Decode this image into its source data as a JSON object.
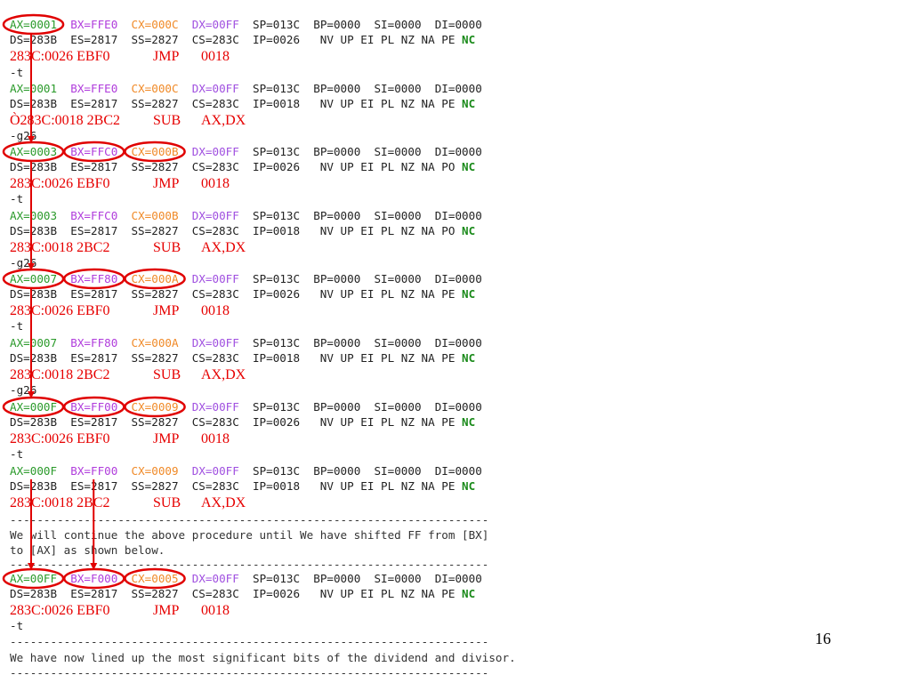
{
  "colors": {
    "ax": "#2a9a2a",
    "bx": "#b03cdc",
    "cx": "#f08a28",
    "dx": "#a050e0",
    "plain": "#222222",
    "nc": "#1a8a1a",
    "instruction": "#e60000",
    "annotation": "#e00000"
  },
  "page_number": "16",
  "lines": [
    {
      "kind": "regs",
      "parts": [
        {
          "text": "AX=0001",
          "reg": "ax"
        },
        {
          "text": "  "
        },
        {
          "text": "BX=FFE0",
          "reg": "bx"
        },
        {
          "text": "  "
        },
        {
          "text": "CX=000C",
          "reg": "cx"
        },
        {
          "text": "  "
        },
        {
          "text": "DX=00FF",
          "reg": "dx"
        },
        {
          "text": "  SP=013C  BP=0000  SI=0000  DI=0000"
        }
      ]
    },
    {
      "kind": "seg",
      "text": "DS=283B  ES=2817  SS=2827  CS=283C  IP=0026   NV UP EI PL NZ NA PE ",
      "flag": "NC"
    },
    {
      "kind": "instr",
      "addr": "283C:0026 EBF0",
      "op": "JMP",
      "arg": "0018"
    },
    {
      "kind": "cmd",
      "text": "-t"
    },
    {
      "kind": "regs",
      "parts": [
        {
          "text": "AX=0001",
          "reg": "ax"
        },
        {
          "text": "  "
        },
        {
          "text": "BX=FFE0",
          "reg": "bx"
        },
        {
          "text": "  "
        },
        {
          "text": "CX=000C",
          "reg": "cx"
        },
        {
          "text": "  "
        },
        {
          "text": "DX=00FF",
          "reg": "dx"
        },
        {
          "text": "  SP=013C  BP=0000  SI=0000  DI=0000"
        }
      ]
    },
    {
      "kind": "seg",
      "text": "DS=283B  ES=2817  SS=2827  CS=283C  IP=0018   NV UP EI PL NZ NA PE ",
      "flag": "NC"
    },
    {
      "kind": "instr",
      "addr": "Ò283C:0018 2BC2",
      "op": "SUB",
      "arg": "AX,DX"
    },
    {
      "kind": "cmd",
      "text": "-g26"
    },
    {
      "kind": "regs",
      "parts": [
        {
          "text": "AX=0003",
          "reg": "ax"
        },
        {
          "text": "  "
        },
        {
          "text": "BX=FFC0",
          "reg": "bx"
        },
        {
          "text": "  "
        },
        {
          "text": "CX=000B",
          "reg": "cx"
        },
        {
          "text": "  "
        },
        {
          "text": "DX=00FF",
          "reg": "dx"
        },
        {
          "text": "  SP=013C  BP=0000  SI=0000  DI=0000"
        }
      ]
    },
    {
      "kind": "seg",
      "text": "DS=283B  ES=2817  SS=2827  CS=283C  IP=0026   NV UP EI PL NZ NA PO ",
      "flag": "NC"
    },
    {
      "kind": "instr",
      "addr": "283C:0026 EBF0",
      "op": "JMP",
      "arg": "0018"
    },
    {
      "kind": "cmd",
      "text": "-t"
    },
    {
      "kind": "regs",
      "parts": [
        {
          "text": "AX=0003",
          "reg": "ax"
        },
        {
          "text": "  "
        },
        {
          "text": "BX=FFC0",
          "reg": "bx"
        },
        {
          "text": "  "
        },
        {
          "text": "CX=000B",
          "reg": "cx"
        },
        {
          "text": "  "
        },
        {
          "text": "DX=00FF",
          "reg": "dx"
        },
        {
          "text": "  SP=013C  BP=0000  SI=0000  DI=0000"
        }
      ]
    },
    {
      "kind": "seg",
      "text": "DS=283B  ES=2817  SS=2827  CS=283C  IP=0018   NV UP EI PL NZ NA PO ",
      "flag": "NC"
    },
    {
      "kind": "instr",
      "addr": "283C:0018 2BC2",
      "op": "SUB",
      "arg": "AX,DX"
    },
    {
      "kind": "cmd",
      "text": "-g26"
    },
    {
      "kind": "regs",
      "parts": [
        {
          "text": "AX=0007",
          "reg": "ax"
        },
        {
          "text": "  "
        },
        {
          "text": "BX=FF80",
          "reg": "bx"
        },
        {
          "text": "  "
        },
        {
          "text": "CX=000A",
          "reg": "cx"
        },
        {
          "text": "  "
        },
        {
          "text": "DX=00FF",
          "reg": "dx"
        },
        {
          "text": "  SP=013C  BP=0000  SI=0000  DI=0000"
        }
      ]
    },
    {
      "kind": "seg",
      "text": "DS=283B  ES=2817  SS=2827  CS=283C  IP=0026   NV UP EI PL NZ NA PE ",
      "flag": "NC"
    },
    {
      "kind": "instr",
      "addr": "283C:0026 EBF0",
      "op": "JMP",
      "arg": "0018"
    },
    {
      "kind": "cmd",
      "text": "-t"
    },
    {
      "kind": "regs",
      "parts": [
        {
          "text": "AX=0007",
          "reg": "ax"
        },
        {
          "text": "  "
        },
        {
          "text": "BX=FF80",
          "reg": "bx"
        },
        {
          "text": "  "
        },
        {
          "text": "CX=000A",
          "reg": "cx"
        },
        {
          "text": "  "
        },
        {
          "text": "DX=00FF",
          "reg": "dx"
        },
        {
          "text": "  SP=013C  BP=0000  SI=0000  DI=0000"
        }
      ]
    },
    {
      "kind": "seg",
      "text": "DS=283B  ES=2817  SS=2827  CS=283C  IP=0018   NV UP EI PL NZ NA PE ",
      "flag": "NC"
    },
    {
      "kind": "instr",
      "addr": "283C:0018 2BC2",
      "op": "SUB",
      "arg": "AX,DX"
    },
    {
      "kind": "cmd",
      "text": "-g26"
    },
    {
      "kind": "regs",
      "parts": [
        {
          "text": "AX=000F",
          "reg": "ax"
        },
        {
          "text": "  "
        },
        {
          "text": "BX=FF00",
          "reg": "bx"
        },
        {
          "text": "  "
        },
        {
          "text": "CX=0009",
          "reg": "cx"
        },
        {
          "text": "  "
        },
        {
          "text": "DX=00FF",
          "reg": "dx"
        },
        {
          "text": "  SP=013C  BP=0000  SI=0000  DI=0000"
        }
      ]
    },
    {
      "kind": "seg",
      "text": "DS=283B  ES=2817  SS=2827  CS=283C  IP=0026   NV UP EI PL NZ NA PE ",
      "flag": "NC"
    },
    {
      "kind": "instr",
      "addr": "283C:0026 EBF0",
      "op": "JMP",
      "arg": "0018"
    },
    {
      "kind": "cmd",
      "text": "-t"
    },
    {
      "kind": "regs",
      "parts": [
        {
          "text": "AX=000F",
          "reg": "ax"
        },
        {
          "text": "  "
        },
        {
          "text": "BX=FF00",
          "reg": "bx"
        },
        {
          "text": "  "
        },
        {
          "text": "CX=0009",
          "reg": "cx"
        },
        {
          "text": "  "
        },
        {
          "text": "DX=00FF",
          "reg": "dx"
        },
        {
          "text": "  SP=013C  BP=0000  SI=0000  DI=0000"
        }
      ]
    },
    {
      "kind": "seg",
      "text": "DS=283B  ES=2817  SS=2827  CS=283C  IP=0018   NV UP EI PL NZ NA PE ",
      "flag": "NC"
    },
    {
      "kind": "instr",
      "addr": "283C:0018 2BC2",
      "op": "SUB",
      "arg": "AX,DX"
    },
    {
      "kind": "text",
      "text": "-----------------------------------------------------------------------"
    },
    {
      "kind": "text",
      "text": "We will continue the above procedure until We have shifted FF from [BX]"
    },
    {
      "kind": "text",
      "text": "to [AX] as shown below."
    },
    {
      "kind": "text",
      "text": "-----------------------------------------------------------------------"
    },
    {
      "kind": "regs",
      "parts": [
        {
          "text": "AX=00FF",
          "reg": "ax"
        },
        {
          "text": "  "
        },
        {
          "text": "BX=F000",
          "reg": "bx"
        },
        {
          "text": "  "
        },
        {
          "text": "CX=0005",
          "reg": "cx"
        },
        {
          "text": "  "
        },
        {
          "text": "DX=00FF",
          "reg": "dx"
        },
        {
          "text": "  SP=013C  BP=0000  SI=0000  DI=0000"
        }
      ]
    },
    {
      "kind": "seg",
      "text": "DS=283B  ES=2817  SS=2827  CS=283C  IP=0026   NV UP EI PL NZ NA PE ",
      "flag": "NC"
    },
    {
      "kind": "instr",
      "addr": "283C:0026 EBF0",
      "op": "JMP",
      "arg": "0018"
    },
    {
      "kind": "cmd",
      "text": "-t"
    },
    {
      "kind": "text",
      "text": "-----------------------------------------------------------------------"
    },
    {
      "kind": "text",
      "text": "We have now lined up the most significant bits of the dividend and divisor."
    },
    {
      "kind": "text",
      "text": "-----------------------------------------------------------------------"
    }
  ]
}
